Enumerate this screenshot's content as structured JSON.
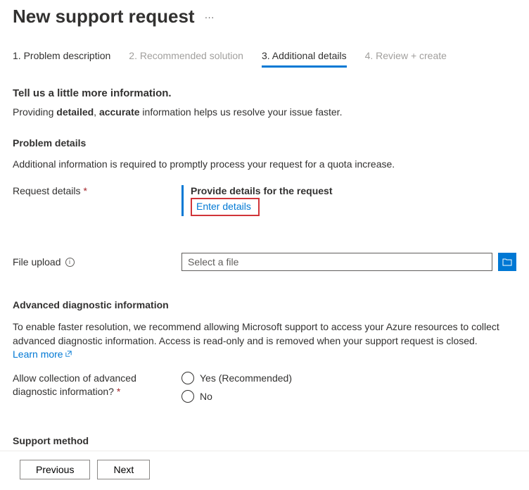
{
  "header": {
    "title": "New support request"
  },
  "tabs": [
    {
      "label": "1. Problem description",
      "state": "completed"
    },
    {
      "label": "2. Recommended solution",
      "state": "disabled"
    },
    {
      "label": "3. Additional details",
      "state": "active"
    },
    {
      "label": "4. Review + create",
      "state": "disabled"
    }
  ],
  "intro": {
    "heading": "Tell us a little more information.",
    "text_prefix": "Providing ",
    "bold1": "detailed",
    "sep": ", ",
    "bold2": "accurate",
    "text_suffix": " information helps us resolve your issue faster."
  },
  "problem_details": {
    "heading": "Problem details",
    "description": "Additional information is required to promptly process your request for a quota increase.",
    "request_label": "Request details",
    "provide_title": "Provide details for the request",
    "enter_link": "Enter details",
    "file_label": "File upload",
    "file_placeholder": "Select a file"
  },
  "advanced": {
    "heading": "Advanced diagnostic information",
    "text": "To enable faster resolution, we recommend allowing Microsoft support to access your Azure resources to collect advanced diagnostic information. Access is read-only and is removed when your support request is closed.",
    "learn_more": "Learn more",
    "allow_label": "Allow collection of advanced diagnostic information?",
    "options": {
      "yes": "Yes (Recommended)",
      "no": "No"
    }
  },
  "support_method": {
    "heading": "Support method"
  },
  "footer": {
    "previous": "Previous",
    "next": "Next"
  }
}
